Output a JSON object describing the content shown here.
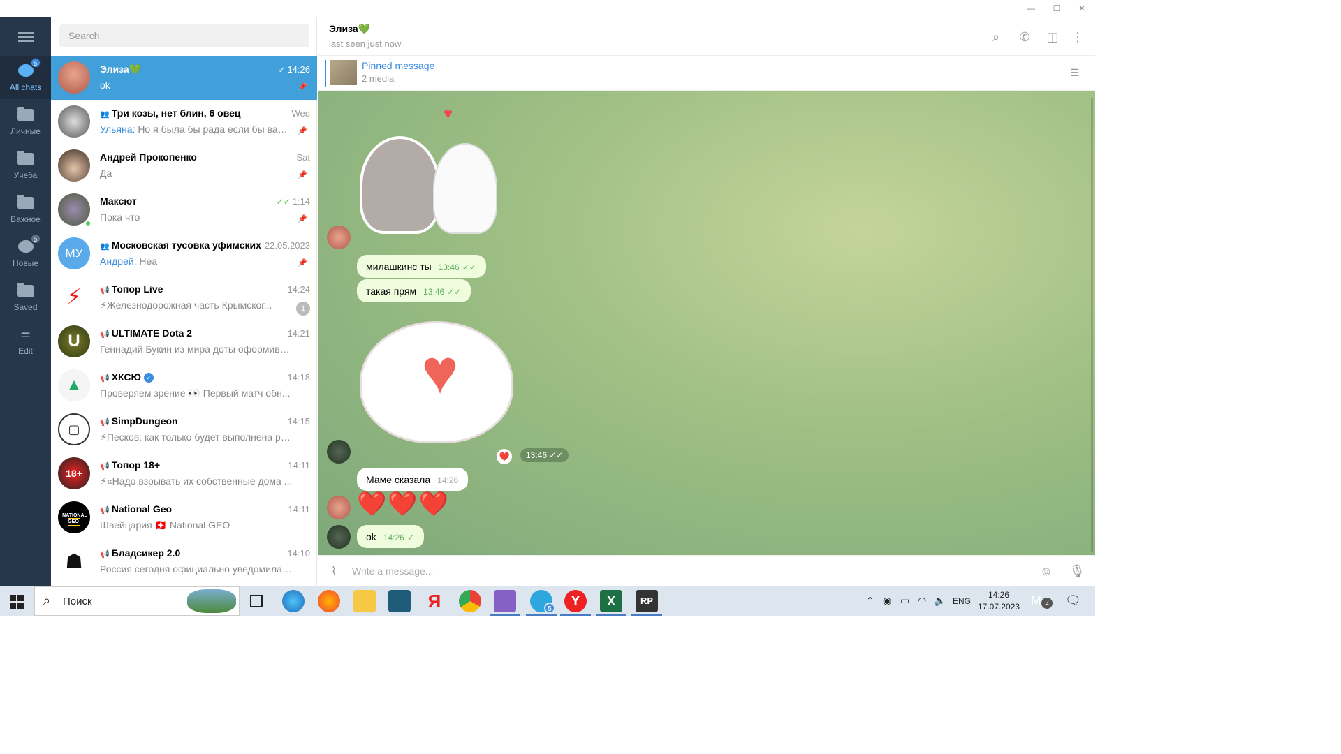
{
  "window": {
    "minimize_icon": "minimize-icon",
    "maximize_icon": "maximize-icon",
    "close_icon": "close-icon"
  },
  "folders": [
    {
      "label": "All chats",
      "badge": "5",
      "icon": "chats-icon",
      "active": true
    },
    {
      "label": "Личные",
      "icon": "folder-icon"
    },
    {
      "label": "Учеба",
      "icon": "folder-icon"
    },
    {
      "label": "Важное",
      "icon": "folder-icon"
    },
    {
      "label": "Новые",
      "badge": "5",
      "icon": "chats-icon"
    },
    {
      "label": "Saved",
      "icon": "folder-icon"
    },
    {
      "label": "Edit",
      "icon": "edit-icon"
    }
  ],
  "search": {
    "placeholder": "Search"
  },
  "chats": [
    {
      "name": "Элиза💚",
      "time": "14:26",
      "preview": "ok",
      "sender": "",
      "pinned": true,
      "active": true,
      "read": true
    },
    {
      "name": "Три козы, нет блин, 6 овец",
      "time": "Wed",
      "sender": "Ульяна:",
      "preview": "Но я была бы рада если бы ваши ...",
      "pinned": true,
      "group": true
    },
    {
      "name": "Андрей Прокопенко",
      "time": "Sat",
      "preview": "Да",
      "pinned": true
    },
    {
      "name": "Максют",
      "time": "1:14",
      "preview": "Пока что",
      "pinned": true,
      "read": true,
      "online": true
    },
    {
      "name": "Московская тусовка уфимских",
      "time": "22.05.2023",
      "sender": "Андрей:",
      "preview": "Неа",
      "pinned": true,
      "group": true,
      "avatar_text": "МУ"
    },
    {
      "name": "Топор Live",
      "time": "14:24",
      "preview": "⚡Железнодорожная часть Крымског...",
      "unread": "1",
      "channel": true
    },
    {
      "name": "ULTIMATE Dota 2",
      "time": "14:21",
      "preview": "Геннадий Букин из мира доты оформивш...",
      "channel": true
    },
    {
      "name": "ХКСЮ",
      "time": "14:18",
      "preview": "Проверяем зрение 👀  Первый матч обн...",
      "channel": true,
      "verified": true
    },
    {
      "name": "SimpDungeon",
      "time": "14:15",
      "preview": "⚡Песков: как только будет выполнена росс...",
      "channel": true
    },
    {
      "name": "Топор 18+",
      "time": "14:11",
      "preview": "⚡«Надо взрывать их собственные дома ...",
      "channel": true
    },
    {
      "name": "National Geo",
      "time": "14:11",
      "preview": "Швейцария 🇨🇭 National GEO",
      "channel": true,
      "avatar_text": "NATIONAL GEO"
    },
    {
      "name": "Бладсикер 2.0",
      "time": "14:10",
      "preview": "Россия сегодня официально уведомила Турц...",
      "channel": true
    }
  ],
  "chat": {
    "name": "Элиза💚",
    "status": "last seen just now",
    "pinned_title": "Pinned message",
    "pinned_sub": "2 media",
    "messages": [
      {
        "text": "милашкинс ты",
        "time": "13:46",
        "out": true
      },
      {
        "text": "такая прям",
        "time": "13:46",
        "out": true
      },
      {
        "text": "",
        "time": "13:46",
        "sticker": true,
        "reaction": "❤️"
      },
      {
        "text": "Маме сказала",
        "time": "14:26",
        "out": false
      },
      {
        "text": "❤️❤️❤️",
        "time": "",
        "out": false,
        "emoji": true
      },
      {
        "text": "ok",
        "time": "14:26",
        "out": true
      }
    ],
    "input_placeholder": "Write a message..."
  },
  "taskbar": {
    "search_label": "Поиск",
    "lang": "ENG",
    "time": "14:26",
    "date": "17.07.2023",
    "telegram_badge": "5",
    "notif_badge": "2"
  },
  "colors": {
    "accent": "#419fd9",
    "rail": "#26364b",
    "bubble_out": "#effdde"
  }
}
